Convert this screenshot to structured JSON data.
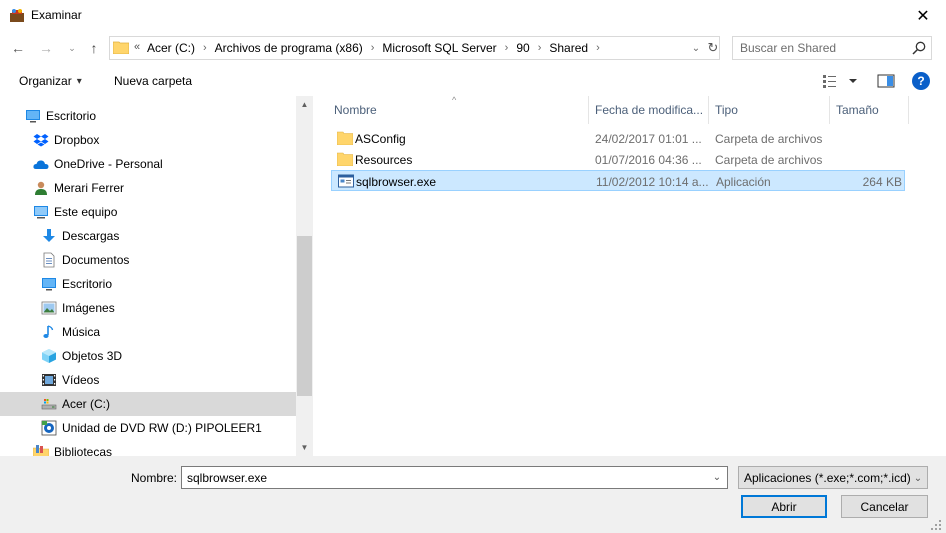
{
  "window": {
    "title": "Examinar",
    "close_glyph": "✕"
  },
  "nav": {
    "back_icon": "←",
    "forward_icon": "→",
    "recent_icon": "⌄",
    "up_icon": "↑"
  },
  "address": {
    "overflow": "«",
    "crumbs": [
      "Acer (C:)",
      "Archivos de programa (x86)",
      "Microsoft SQL Server",
      "90",
      "Shared"
    ],
    "separator": "›",
    "dropdown_icon": "⌄",
    "refresh_icon": "↻"
  },
  "search": {
    "placeholder": "Buscar en Shared"
  },
  "toolbar": {
    "organize_label": "Organizar",
    "organize_chevron": "▾",
    "new_folder_label": "Nueva carpeta",
    "help_label": "?"
  },
  "sidebar": {
    "items": [
      {
        "label": "Escritorio",
        "icon": "desktop-icon",
        "indent": 0
      },
      {
        "label": "Dropbox",
        "icon": "dropbox-icon",
        "indent": 1
      },
      {
        "label": "OneDrive - Personal",
        "icon": "onedrive-icon",
        "indent": 1
      },
      {
        "label": "Merari Ferrer",
        "icon": "user-icon",
        "indent": 1
      },
      {
        "label": "Este equipo",
        "icon": "computer-icon",
        "indent": 1
      },
      {
        "label": "Descargas",
        "icon": "downloads-icon",
        "indent": 2
      },
      {
        "label": "Documentos",
        "icon": "documents-icon",
        "indent": 2
      },
      {
        "label": "Escritorio",
        "icon": "desktop-icon",
        "indent": 2
      },
      {
        "label": "Imágenes",
        "icon": "pictures-icon",
        "indent": 2
      },
      {
        "label": "Música",
        "icon": "music-icon",
        "indent": 2
      },
      {
        "label": "Objetos 3D",
        "icon": "3d-objects-icon",
        "indent": 2
      },
      {
        "label": "Vídeos",
        "icon": "videos-icon",
        "indent": 2
      },
      {
        "label": "Acer (C:)",
        "icon": "drive-icon",
        "indent": 2,
        "selected": true
      },
      {
        "label": "Unidad de DVD RW (D:) PIPOLEER1",
        "icon": "dvd-icon",
        "indent": 2
      },
      {
        "label": "Bibliotecas",
        "icon": "libraries-icon",
        "indent": 1
      }
    ],
    "scroll_up": "▲",
    "scroll_down": "▼"
  },
  "files": {
    "columns": {
      "name": "Nombre",
      "date": "Fecha de modifica...",
      "type": "Tipo",
      "size": "Tamaño"
    },
    "sort_indicator": "^",
    "rows": [
      {
        "name": "ASConfig",
        "date": "24/02/2017 01:01 ...",
        "type": "Carpeta de archivos",
        "size": "",
        "icon": "folder-icon"
      },
      {
        "name": "Resources",
        "date": "01/07/2016 04:36 ...",
        "type": "Carpeta de archivos",
        "size": "",
        "icon": "folder-icon"
      },
      {
        "name": "sqlbrowser.exe",
        "date": "11/02/2012 10:14 a...",
        "type": "Aplicación",
        "size": "264 KB",
        "icon": "application-icon",
        "selected": true
      }
    ]
  },
  "footer": {
    "name_label": "Nombre:",
    "name_value": "sqlbrowser.exe",
    "filter_value": "Aplicaciones (*.exe;*.com;*.icd)",
    "open_label": "Abrir",
    "cancel_label": "Cancelar",
    "dropdown_icon": "⌄"
  },
  "colors": {
    "selection_bg": "#cce8ff",
    "selection_border": "#99d1ff",
    "nav_selected_bg": "#d9d9d9",
    "accent": "#0078d7",
    "header_text": "#4c607a",
    "folder": "#ffd56b"
  }
}
